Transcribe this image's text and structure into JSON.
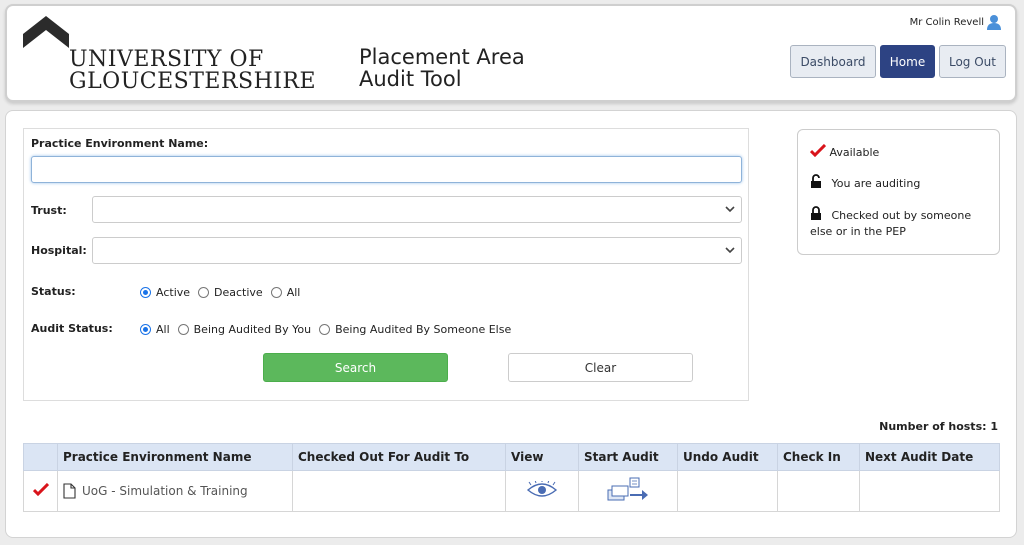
{
  "header": {
    "university_line1": "UNIVERSITY OF",
    "university_line2": "GLOUCESTERSHIRE",
    "app_title_line1": "Placement Area",
    "app_title_line2": "Audit Tool",
    "user_name": "Mr Colin Revell",
    "nav": {
      "dashboard": "Dashboard",
      "home": "Home",
      "logout": "Log Out"
    }
  },
  "search": {
    "pe_name_label": "Practice Environment Name:",
    "pe_name_value": "",
    "trust_label": "Trust:",
    "trust_value": "",
    "hospital_label": "Hospital:",
    "hospital_value": "",
    "status_label": "Status:",
    "status_options": [
      "Active",
      "Deactive",
      "All"
    ],
    "status_selected": "Active",
    "audit_status_label": "Audit Status:",
    "audit_status_options": [
      "All",
      "Being Audited By You",
      "Being Audited By Someone Else"
    ],
    "audit_status_selected": "All",
    "search_button": "Search",
    "clear_button": "Clear"
  },
  "legend": {
    "available": "Available",
    "you_auditing": "You are auditing",
    "checked_out_line1": "Checked out by someone",
    "checked_out_line2": "else or in the PEP"
  },
  "results": {
    "host_count_label": "Number of hosts: 1",
    "columns": [
      "",
      "Practice Environment Name",
      "Checked Out For Audit To",
      "View",
      "Start Audit",
      "Undo Audit",
      "Check In",
      "Next Audit Date"
    ],
    "rows": [
      {
        "status_icon": "check-icon",
        "name": "UoG - Simulation & Training",
        "checked_out_to": "",
        "undo_audit": "",
        "check_in": "",
        "next_audit_date": ""
      }
    ]
  },
  "colors": {
    "primary_nav": "#2d4383",
    "search_green": "#5cb85c",
    "available_red": "#d9141b",
    "table_header": "#dbe5f4"
  }
}
